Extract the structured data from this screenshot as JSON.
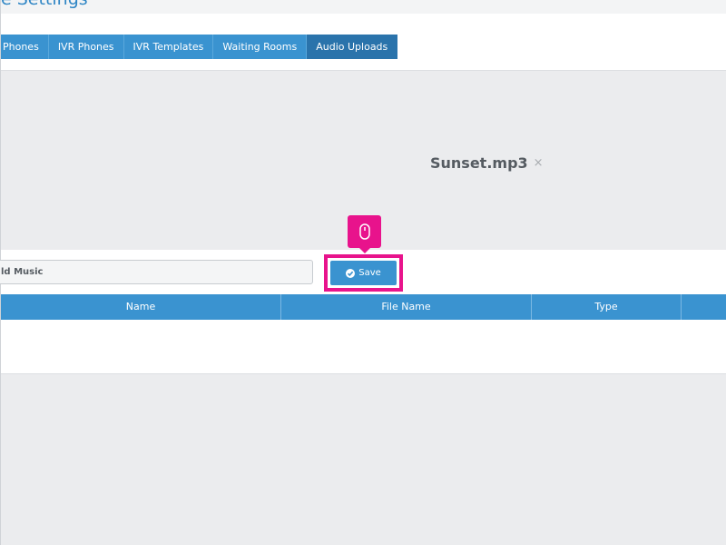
{
  "header": {
    "title": "e Settings"
  },
  "tabs": [
    {
      "label": "Phones",
      "active": false
    },
    {
      "label": "IVR Phones",
      "active": false
    },
    {
      "label": "IVR Templates",
      "active": false
    },
    {
      "label": "Waiting Rooms",
      "active": false
    },
    {
      "label": "Audio Uploads",
      "active": true
    }
  ],
  "upload": {
    "file_name": "Sunset.mp3",
    "remove_glyph": "×"
  },
  "form": {
    "name_value": "ld Music",
    "save_label": "Save"
  },
  "table": {
    "columns": [
      "Name",
      "File Name",
      "Type",
      ""
    ]
  },
  "colors": {
    "accent": "#3a93d0",
    "active_tab": "#2a73ab",
    "highlight": "#e8138c"
  },
  "icons": {
    "save": "check-circle-icon",
    "cursor_hint": "mouse-icon",
    "remove": "close-icon"
  }
}
